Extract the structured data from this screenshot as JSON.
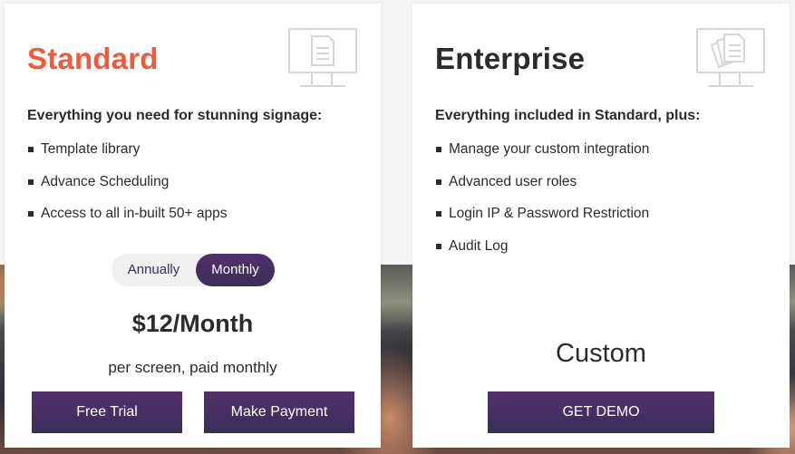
{
  "plans": {
    "standard": {
      "title": "Standard",
      "icon": "monitor-document-icon",
      "intro": "Everything you need for stunning signage:",
      "features": [
        "Template library",
        "Advance Scheduling",
        "Access to all in-built 50+ apps"
      ],
      "billing_toggle": {
        "options": [
          "Annually",
          "Monthly"
        ],
        "selected": "Monthly"
      },
      "price": "$12/Month",
      "price_note": "per screen, paid monthly",
      "buttons": {
        "free_trial": "Free Trial",
        "make_payment": "Make Payment"
      }
    },
    "enterprise": {
      "title": "Enterprise",
      "icon": "monitor-documents-stack-icon",
      "intro": "Everything included in Standard, plus:",
      "features": [
        "Manage your custom integration",
        "Advanced user roles",
        "Login IP & Password Restriction",
        "Audit Log"
      ],
      "price": "Custom",
      "buttons": {
        "get_demo": "GET DEMO"
      }
    }
  },
  "colors": {
    "standard_title": "#f15a3a",
    "button_gradient_top": "#552f6d",
    "button_gradient_bottom": "#372f58",
    "toggle_track": "#f0f0f0",
    "page_background": "#f5f5f5"
  }
}
